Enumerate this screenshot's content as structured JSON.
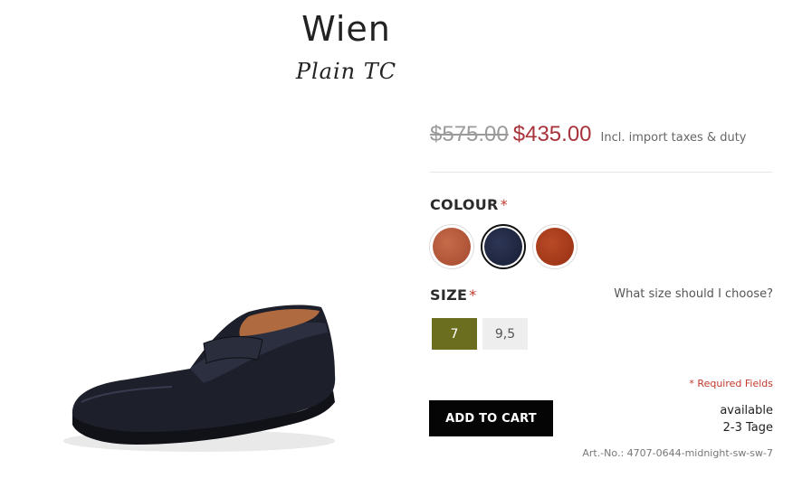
{
  "product": {
    "name": "Wien",
    "model": "Plain TC",
    "image_icon": "loafer-shoe-image"
  },
  "pricing": {
    "original_price": "$575.00",
    "sale_price": "$435.00",
    "tax_note": "Incl. import taxes & duty"
  },
  "colour": {
    "label": "COLOUR",
    "required_marker": "*",
    "options": [
      {
        "name": "light-brown",
        "color": "#b5593a",
        "selected": false
      },
      {
        "name": "midnight",
        "color": "#1f2742",
        "selected": true
      },
      {
        "name": "chestnut",
        "color": "#a83a1b",
        "selected": false
      }
    ]
  },
  "size": {
    "label": "SIZE",
    "required_marker": "*",
    "help_link": "What size should I choose?",
    "options": [
      {
        "label": "7",
        "selected": true
      },
      {
        "label": "9,5",
        "selected": false
      }
    ]
  },
  "required_fields_note": "* Required Fields",
  "cart": {
    "button_label": "ADD TO CART"
  },
  "availability": {
    "status": "available",
    "delivery": "2-3 Tage"
  },
  "article_number": "Art.-No.: 4707-0644-midnight-sw-sw-7",
  "colors": {
    "sale_price": "#a8323a",
    "size_selected": "#6b6e1f",
    "cart_button": "#050505"
  }
}
